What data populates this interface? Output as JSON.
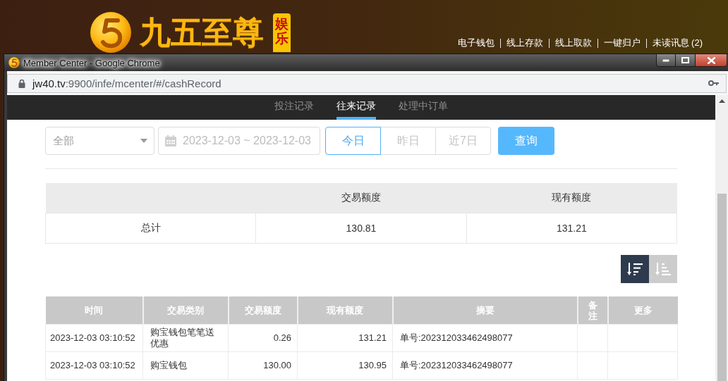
{
  "site_header": {
    "name": "九五至尊",
    "badge": "娱乐",
    "links": [
      "电子钱包",
      "线上存款",
      "线上取款",
      "一键归户",
      "未读讯息 (2)"
    ]
  },
  "browser": {
    "title": "Member Center - Google Chrome",
    "url": {
      "host": "jw40.tv",
      "path": ":9900/infe/mcenter/#/cashRecord"
    }
  },
  "tabs": [
    {
      "label": "投注记录",
      "selected": false
    },
    {
      "label": "往来记录",
      "selected": true
    },
    {
      "label": "处理中订单",
      "selected": false
    }
  ],
  "filter": {
    "type_select": {
      "value": "全部"
    },
    "date_range": {
      "value": "2023-12-03 ~ 2023-12-03"
    },
    "quick_ranges": [
      {
        "label": "今日",
        "selected": true
      },
      {
        "label": "昨日",
        "selected": false
      },
      {
        "label": "近7日",
        "selected": false
      }
    ],
    "search_button": "查询"
  },
  "summary": {
    "columns": [
      "交易额度",
      "现有额度"
    ],
    "rows": [
      {
        "label": "总计",
        "values": [
          "130.81",
          "131.21"
        ]
      }
    ]
  },
  "sort_buttons": [
    {
      "kind": "descending",
      "selected": true
    },
    {
      "kind": "ascending",
      "selected": false
    }
  ],
  "records": {
    "columns": [
      "时间",
      "交易类别",
      "交易额度",
      "现有额度",
      "摘要",
      "备注",
      "更多"
    ],
    "rows": [
      {
        "time": "2023-12-03 03:10:52",
        "category": "购宝钱包笔笔送优惠",
        "amount": "0.26",
        "balance": "131.21",
        "summary": "单号:202312033462498077"
      },
      {
        "time": "2023-12-03 03:10:52",
        "category": "购宝钱包",
        "amount": "130.00",
        "balance": "130.95",
        "summary": "单号:202312033462498077"
      }
    ]
  }
}
